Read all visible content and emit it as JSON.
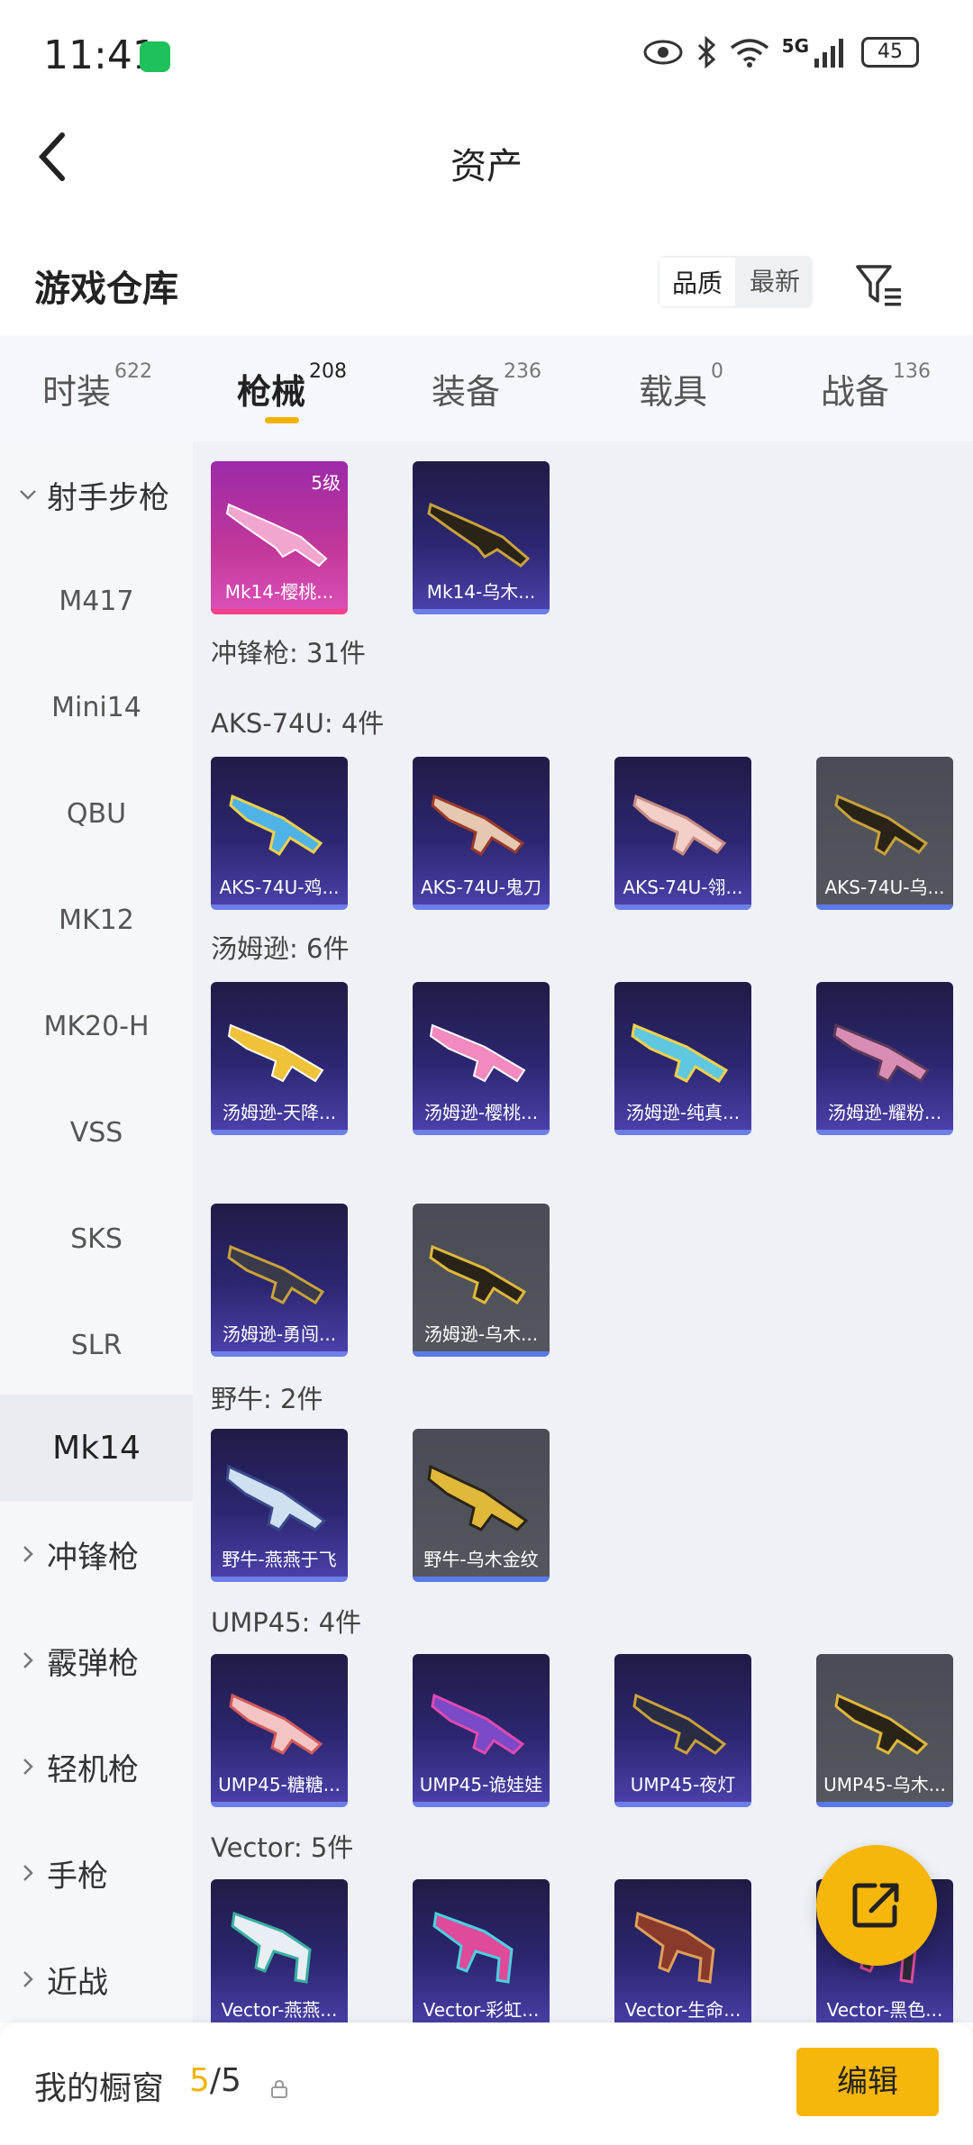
{
  "status_bar": {
    "time": "11:41",
    "network": "5G",
    "battery": "45"
  },
  "nav": {
    "title": "资产"
  },
  "section": {
    "title": "游戏仓库",
    "sort_options": [
      "品质",
      "最新"
    ]
  },
  "tabs": [
    {
      "label": "时装",
      "count": "622"
    },
    {
      "label": "枪械",
      "count": "208"
    },
    {
      "label": "装备",
      "count": "236"
    },
    {
      "label": "载具",
      "count": "0"
    },
    {
      "label": "战备",
      "count": "136"
    }
  ],
  "sidebar": {
    "group_open": "射手步枪",
    "items": [
      "M417",
      "Mini14",
      "QBU",
      "MK12",
      "MK20-H",
      "VSS",
      "SKS",
      "SLR",
      "Mk14"
    ],
    "groups_collapsed": [
      "冲锋枪",
      "霰弹枪",
      "轻机枪",
      "手枪",
      "近战"
    ]
  },
  "content": {
    "mk14_cards": [
      {
        "name": "Mk14-樱桃...",
        "level": "5级"
      },
      {
        "name": "Mk14-乌木..."
      }
    ],
    "smg_label": "冲锋枪: 31件",
    "aks_label": "AKS-74U: 4件",
    "aks_cards": [
      "AKS-74U-鸡...",
      "AKS-74U-鬼刀",
      "AKS-74U-翎...",
      "AKS-74U-乌..."
    ],
    "tommy_label": "汤姆逊: 6件",
    "tommy_cards": [
      "汤姆逊-天降...",
      "汤姆逊-樱桃...",
      "汤姆逊-纯真...",
      "汤姆逊-耀粉...",
      "汤姆逊-勇闯...",
      "汤姆逊-乌木..."
    ],
    "bizon_label": "野牛: 2件",
    "bizon_cards": [
      "野牛-燕燕于飞",
      "野牛-乌木金纹"
    ],
    "ump_label": "UMP45: 4件",
    "ump_cards": [
      "UMP45-糖糖...",
      "UMP45-诡娃娃",
      "UMP45-夜灯",
      "UMP45-乌木..."
    ],
    "vector_label": "Vector: 5件",
    "vector_cards": [
      "Vector-燕燕...",
      "Vector-彩虹...",
      "Vector-生命...",
      "Vector-黑色..."
    ]
  },
  "bottom": {
    "label": "我的橱窗",
    "current": "5",
    "total": "/5",
    "edit": "编辑"
  },
  "colors": {
    "accent": "#f6b60a",
    "tab_indicator": "#f0b400"
  }
}
